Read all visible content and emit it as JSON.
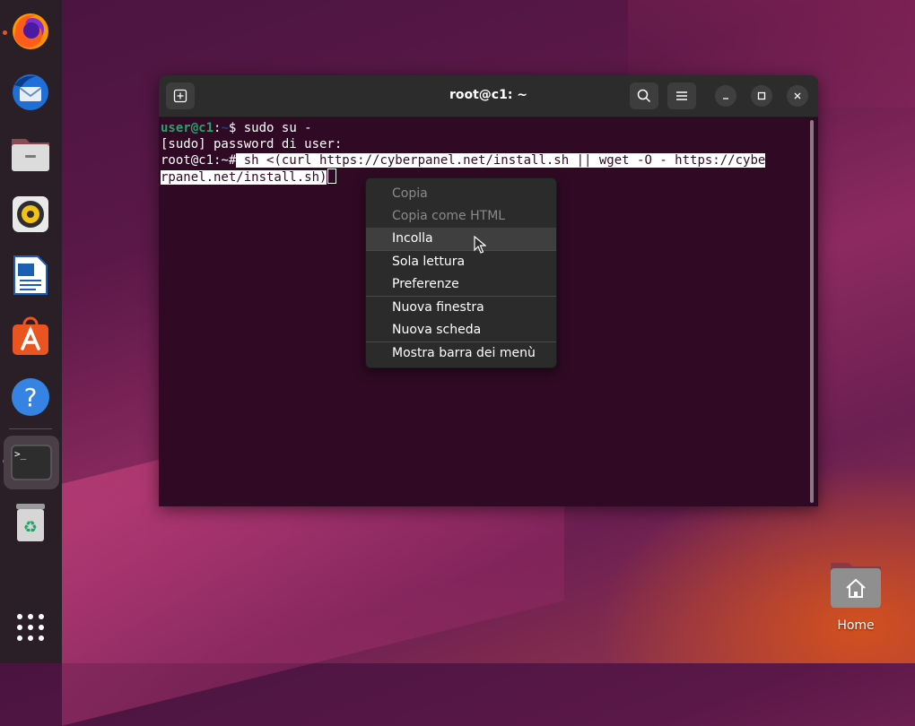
{
  "dock": {
    "items": [
      {
        "name": "firefox",
        "icon": "firefox-icon",
        "running": true
      },
      {
        "name": "thunderbird",
        "icon": "thunderbird-icon",
        "running": false
      },
      {
        "name": "files",
        "icon": "files-icon",
        "running": false
      },
      {
        "name": "rhythmbox",
        "icon": "rhythmbox-icon",
        "running": false
      },
      {
        "name": "writer",
        "icon": "writer-icon",
        "running": false
      },
      {
        "name": "app-center",
        "icon": "app-center-icon",
        "running": false
      },
      {
        "name": "help",
        "icon": "help-icon",
        "running": false
      },
      {
        "name": "terminal",
        "icon": "terminal-icon",
        "running": true,
        "active": true
      },
      {
        "name": "trash",
        "icon": "trash-icon",
        "running": false
      },
      {
        "name": "show-apps",
        "icon": "app-grid-icon",
        "running": false
      }
    ]
  },
  "window": {
    "title": "root@c1: ~",
    "icons": [
      "new-tab-icon",
      "search-icon",
      "hamburger-menu-icon",
      "minimize-icon",
      "maximize-icon",
      "close-icon"
    ]
  },
  "terminal": {
    "line1": {
      "user": "user@c1",
      "colon": ":",
      "path": "~",
      "rest": "$ sudo su -"
    },
    "line2": "[sudo] password di user:",
    "line3": {
      "prompt": "root@c1:~#",
      "selected": " sh <(curl https://cyberpanel.net/install.sh || wget -O - https://cybe"
    },
    "line4": {
      "selected": "rpanel.net/install.sh)"
    }
  },
  "context_menu": {
    "items": [
      {
        "label": "Copia",
        "enabled": false
      },
      {
        "label": "Copia come HTML",
        "enabled": false
      },
      {
        "label": "Incolla",
        "enabled": true,
        "hover": true
      },
      {
        "label": "Sola lettura",
        "enabled": true
      },
      {
        "label": "Preferenze",
        "enabled": true
      },
      {
        "label": "Nuova finestra",
        "enabled": true
      },
      {
        "label": "Nuova scheda",
        "enabled": true
      },
      {
        "label": "Mostra barra dei menù",
        "enabled": true
      }
    ]
  },
  "desktop": {
    "home_label": "Home"
  },
  "colors": {
    "terminal_bg": "#300a24",
    "prompt_green": "#26a269",
    "prompt_blue": "#12488b",
    "ubuntu_orange": "#e95420"
  }
}
